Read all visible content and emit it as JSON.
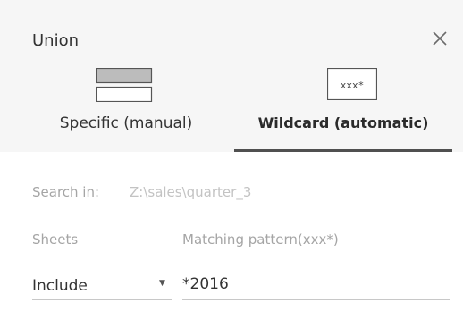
{
  "dialog": {
    "title": "Union",
    "close_icon": "close-icon"
  },
  "tabs": [
    {
      "label": "Specific (manual)",
      "icon": "stacked-tables-icon",
      "active": false
    },
    {
      "label": "Wildcard (automatic)",
      "icon": "wildcard-icon",
      "icon_text": "xxx*",
      "active": true
    }
  ],
  "search": {
    "label": "Search in:",
    "value": "Z:\\sales\\quarter_3"
  },
  "sheets": {
    "label": "Sheets",
    "selected": "Include",
    "dropdown_icon": "chevron-down-icon"
  },
  "matching_pattern": {
    "label": "Matching pattern(xxx*)",
    "value": "*2016"
  },
  "colors": {
    "header_bg": "#f6f6f6",
    "text": "#333333",
    "muted_text": "#a5a5a5",
    "active_tab_underline": "#505050"
  }
}
